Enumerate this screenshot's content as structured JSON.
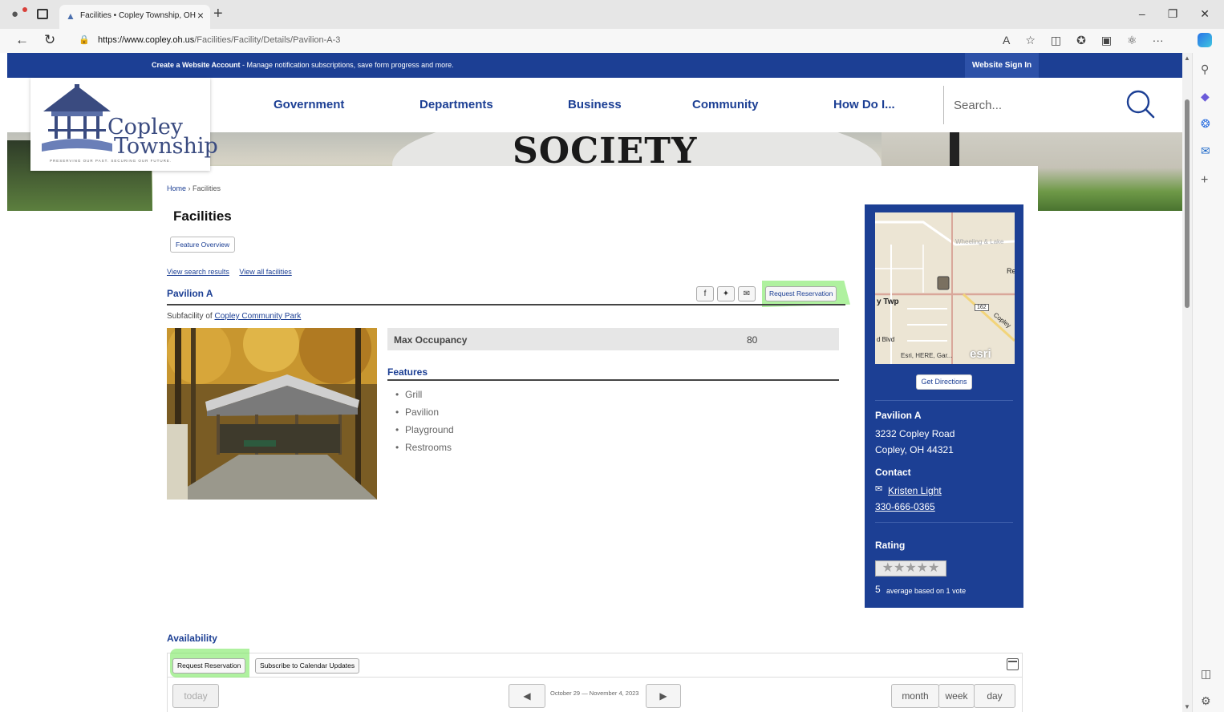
{
  "browser": {
    "tab_title": "Facilities • Copley Township, OH",
    "url_host": "https://www.copley.oh.us",
    "url_path": "/Facilities/Facility/Details/Pavilion-A-3"
  },
  "site": {
    "topbar_strong": "Create a Website Account",
    "topbar_rest": " - Manage notification subscriptions, save form progress and more.",
    "sign_in": "Website Sign In",
    "logo_line1": "Copley",
    "logo_line2": "Township",
    "logo_tagline": "PRESERVING OUR PAST. SECURING OUR FUTURE.",
    "nav": [
      "Government",
      "Departments",
      "Business",
      "Community",
      "How Do I..."
    ],
    "search_placeholder": "Search...",
    "hero_text": "SOCIETY"
  },
  "page": {
    "breadcrumb_home": "Home",
    "breadcrumb_sep": " › ",
    "breadcrumb_current": "Facilities",
    "title": "Facilities",
    "feature_overview": "Feature Overview",
    "view_search_results": "View search results",
    "view_all_facilities": "View all facilities",
    "facility_name": "Pavilion A",
    "request_reservation": "Request Reservation",
    "subfacility_prefix": "Subfacility of ",
    "subfacility_link": "Copley Community Park",
    "max_occupancy_label": "Max Occupancy",
    "max_occupancy_value": "80",
    "features_title": "Features",
    "features": [
      "Grill",
      "Pavilion",
      "Playground",
      "Restrooms"
    ]
  },
  "sidebar": {
    "map_labels": {
      "area_top": "Wheeling & Lake",
      "twp": "y Twp",
      "re": "Re",
      "route": "162",
      "road": "Copley",
      "blvd": "d Blvd",
      "attribution": "Esri, HERE, Gar...",
      "esri": "esri"
    },
    "get_directions": "Get Directions",
    "name": "Pavilion A",
    "address1": "3232 Copley Road",
    "address2": "Copley, OH 44321",
    "contact_heading": "Contact",
    "contact_name": "Kristen Light",
    "contact_phone": "330-666-0365",
    "rating_heading": "Rating",
    "stars": "★★★★★",
    "rating_value": "5",
    "rating_text": "average based on 1 vote"
  },
  "availability": {
    "title": "Availability",
    "request_reservation": "Request Reservation",
    "subscribe": "Subscribe to Calendar Updates",
    "today": "today",
    "range": "October 29 — November 4, 2023",
    "views": [
      "month",
      "week",
      "day"
    ]
  },
  "colors": {
    "brand_blue": "#1c3f94",
    "highlight_green": "#6ee650"
  }
}
